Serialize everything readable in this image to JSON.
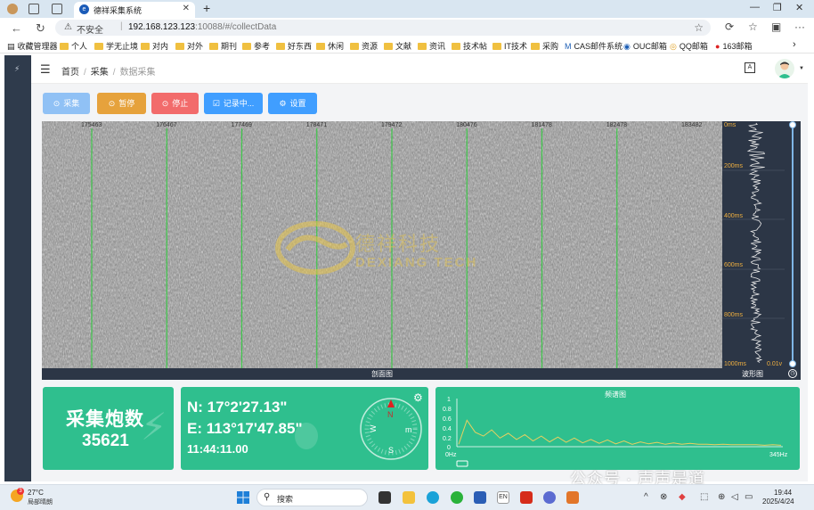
{
  "browser": {
    "tab_title": "德祥采集系统",
    "security_label": "不安全",
    "url_host": "192.168.123.123",
    "url_path": ":10088/#/collectData",
    "bookmarks": [
      "收藏管理器",
      "个人",
      "学无止境",
      "对内",
      "对外",
      "期刊",
      "参考",
      "好东西",
      "休闲",
      "资源",
      "文献",
      "资讯",
      "技术帖",
      "IT技术",
      "采购",
      "CAS邮件系统",
      "OUC邮箱",
      "QQ邮箱",
      "163邮箱"
    ]
  },
  "breadcrumb": {
    "home": "首页",
    "level1": "采集",
    "current": "数据采集"
  },
  "header": {
    "lang_icon_text": "A"
  },
  "toolbar": {
    "collect": "采集",
    "pause": "暂停",
    "stop": "停止",
    "record": "记录中...",
    "settings": "设置",
    "colors": {
      "collect": "#90c1f5",
      "pause": "#e6a23c",
      "stop": "#f26b6b",
      "record": "#409eff",
      "settings": "#409eff"
    }
  },
  "seismic": {
    "trace_labels": [
      "175463",
      "176467",
      "177469",
      "178471",
      "179472",
      "180476",
      "181478",
      "182478",
      "183482"
    ],
    "watermark_cn": "德祥科技",
    "watermark_en": "DEXIANG TECH",
    "section_label": "剖面图"
  },
  "waveform": {
    "time_labels": [
      "0ms",
      "200ms",
      "400ms",
      "600ms",
      "800ms",
      "1000ms"
    ],
    "amp_label": "0.01v",
    "title": "波形图"
  },
  "count_panel": {
    "title": "采集炮数",
    "value": "35621"
  },
  "gps_panel": {
    "lat": "N: 17°2'27.13\"",
    "lon": "E: 113°17'47.85\"",
    "time": "11:44:11.00",
    "compass": {
      "n": "N",
      "s": "S",
      "w": "W",
      "e": "m"
    }
  },
  "spectrum": {
    "title": "频谱图",
    "y_ticks": [
      "1",
      "0.8",
      "0.6",
      "0.4",
      "0.2",
      "0"
    ],
    "x_start": "0Hz",
    "x_end": "345Hz"
  },
  "overlay": {
    "wechat": "公众号 · 声声是道"
  },
  "taskbar": {
    "weather_temp": "27°C",
    "weather_desc": "局部晴朗",
    "weather_badge": "3",
    "search": "搜索",
    "tray_lang": "EN",
    "time": "19:44",
    "date": "2025/4/24"
  },
  "chart_data": {
    "type": "line",
    "title": "频谱图",
    "xlabel": "",
    "ylabel": "",
    "x_range": [
      "0Hz",
      "345Hz"
    ],
    "ylim": [
      0,
      1
    ],
    "series": [
      {
        "values": [
          0.05,
          0.55,
          0.3,
          0.22,
          0.35,
          0.18,
          0.28,
          0.15,
          0.25,
          0.12,
          0.22,
          0.1,
          0.2,
          0.09,
          0.18,
          0.08,
          0.15,
          0.07,
          0.14,
          0.06,
          0.12,
          0.05,
          0.1,
          0.06,
          0.09,
          0.05,
          0.08,
          0.05,
          0.07,
          0.05,
          0.05,
          0.04,
          0.05,
          0.04,
          0.04,
          0.04,
          0.04,
          0.03,
          0.04,
          0.03
        ]
      }
    ]
  }
}
